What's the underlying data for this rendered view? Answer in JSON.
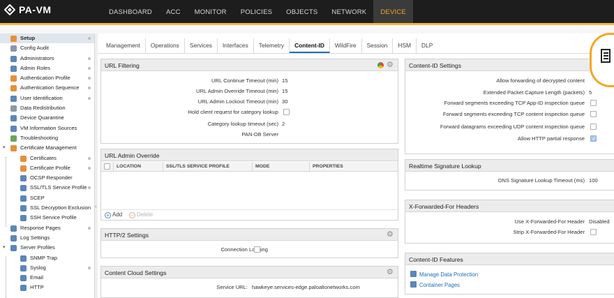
{
  "app": {
    "title": "PA-VM"
  },
  "nav": [
    "DASHBOARD",
    "ACC",
    "MONITOR",
    "POLICIES",
    "OBJECTS",
    "NETWORK",
    "DEVICE"
  ],
  "sidebar": [
    {
      "label": "Setup",
      "icon": "setup-icon"
    },
    {
      "label": "Config Audit",
      "icon": "config-audit-icon"
    },
    {
      "label": "Administrators",
      "icon": "administrators-icon"
    },
    {
      "label": "Admin Roles",
      "icon": "admin-roles-icon"
    },
    {
      "label": "Authentication Profile",
      "icon": "authentication-profile-icon"
    },
    {
      "label": "Authentication Sequence",
      "icon": "authentication-sequence-icon"
    },
    {
      "label": "User Identification",
      "icon": "user-identification-icon"
    },
    {
      "label": "Data Redistribution",
      "icon": "data-redistribution-icon"
    },
    {
      "label": "Device Quarantine",
      "icon": "device-quarantine-icon"
    },
    {
      "label": "VM Information Sources",
      "icon": "vm-information-sources-icon"
    },
    {
      "label": "Troubleshooting",
      "icon": "troubleshooting-icon"
    },
    {
      "label": "Certificate Management",
      "icon": "certificate-management-icon"
    },
    {
      "label": "Certificates",
      "icon": "certificates-icon"
    },
    {
      "label": "Certificate Profile",
      "icon": "certificate-profile-icon"
    },
    {
      "label": "OCSP Responder",
      "icon": "ocsp-responder-icon"
    },
    {
      "label": "SSL/TLS Service Profile",
      "icon": "ssl-tls-service-profile-icon"
    },
    {
      "label": "SCEP",
      "icon": "scep-icon"
    },
    {
      "label": "SSL Decryption Exclusion",
      "icon": "ssl-decryption-exclusion-icon"
    },
    {
      "label": "SSH Service Profile",
      "icon": "ssh-service-profile-icon"
    },
    {
      "label": "Response Pages",
      "icon": "response-pages-icon"
    },
    {
      "label": "Log Settings",
      "icon": "log-settings-icon"
    },
    {
      "label": "Server Profiles",
      "icon": "server-profiles-icon"
    },
    {
      "label": "SNMP Trap",
      "icon": "snmp-trap-icon"
    },
    {
      "label": "Syslog",
      "icon": "syslog-icon"
    },
    {
      "label": "Email",
      "icon": "email-icon"
    },
    {
      "label": "HTTP",
      "icon": "http-icon"
    }
  ],
  "tabs": [
    "Management",
    "Operations",
    "Services",
    "Interfaces",
    "Telemetry",
    "Content-ID",
    "WildFire",
    "Session",
    "HSM",
    "DLP"
  ],
  "url_filtering": {
    "title": "URL Filtering",
    "rows": [
      {
        "label": "URL Continue Timeout (min)",
        "value": "15"
      },
      {
        "label": "URL Admin Override Timeout (min)",
        "value": "15"
      },
      {
        "label": "URL Admin Lockout Timeout (min)",
        "value": "30"
      },
      {
        "label": "Hold client request for category lookup",
        "value": ""
      },
      {
        "label": "Category lookup timeout (sec)",
        "value": "2"
      },
      {
        "label": "PAN-DB Server",
        "value": ""
      }
    ]
  },
  "url_admin_override": {
    "title": "URL Admin Override",
    "columns": [
      "LOCATION",
      "SSL/TLS SERVICE PROFILE",
      "MODE",
      "PROPERTIES"
    ],
    "add_label": "Add",
    "delete_label": "Delete"
  },
  "http2": {
    "title": "HTTP/2 Settings",
    "label": "Connection Logging"
  },
  "content_cloud": {
    "title": "Content Cloud Settings",
    "label": "Service URL:",
    "value": "hawkeye.services-edge.paloaltonetworks.com"
  },
  "content_id_settings": {
    "title": "Content-ID Settings",
    "rows": [
      {
        "label": "Allow forwarding of decrypted content",
        "value": ""
      },
      {
        "label": "Extended Packet Capture Length (packets)",
        "value": "5"
      },
      {
        "label": "Forward segments exceeding TCP App-ID inspection queue",
        "value": ""
      },
      {
        "label": "Forward segments exceeding TCP content inspection queue",
        "value": ""
      },
      {
        "label": "Forward datagrams exceeding UDP content inspection queue",
        "value": ""
      },
      {
        "label": "Allow HTTP partial response",
        "value": ""
      }
    ]
  },
  "realtime_signature": {
    "title": "Realtime Signature Lookup",
    "label": "DNS Signature Lookup Timeout (ms)",
    "value": "100"
  },
  "xff": {
    "title": "X-Forwarded-For Headers",
    "rows": [
      {
        "label": "Use X-Forwarded-For Header",
        "value": "Disabled"
      },
      {
        "label": "Strip X-Forwarded-For Header",
        "value": ""
      }
    ]
  },
  "content_id_features": {
    "title": "Content-ID Features",
    "links": [
      "Manage Data Protection",
      "Container Pages"
    ]
  }
}
